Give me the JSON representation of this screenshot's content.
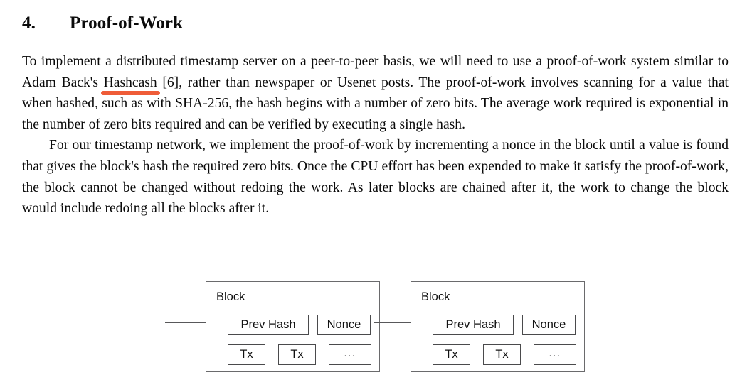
{
  "document": {
    "section": {
      "number": "4.",
      "title": "Proof-of-Work"
    },
    "paragraphs": {
      "p1_part1": "To implement a distributed timestamp server on a peer-to-peer basis, we will need to use a proof-of-work system similar to Adam Back's ",
      "p1_highlight": "Hashcash",
      "p1_part2": " [6], rather than newspaper or Usenet posts.  The proof-of-work involves scanning for a value that when hashed, such as with SHA-256, the hash begins with a number of zero bits.  The average work required is exponential in the number of zero bits required and can be verified by executing a single hash.",
      "p2": "For our timestamp network, we implement the proof-of-work by incrementing a nonce in the block until a value is found that gives the block's hash the required zero bits.  Once the CPU effort has been expended to make it satisfy the proof-of-work, the block cannot be changed without redoing the work.  As later blocks are chained after it, the work to change the block would include redoing all the blocks after it."
    },
    "annotation": {
      "type": "marker-underline",
      "target_word": "Hashcash",
      "color": "#ef5c38"
    }
  },
  "diagram": {
    "name": "blockchain-block-diagram",
    "blocks": [
      {
        "label": "Block",
        "prev_hash": "Prev Hash",
        "nonce": "Nonce",
        "tx1": "Tx",
        "tx2": "Tx",
        "ellipsis": "..."
      },
      {
        "label": "Block",
        "prev_hash": "Prev Hash",
        "nonce": "Nonce",
        "tx1": "Tx",
        "tx2": "Tx",
        "ellipsis": "..."
      }
    ],
    "colors": {
      "box_border": "#6a6a6c",
      "field_border": "#4a4a4c",
      "arrow": "#111111",
      "text": "#111111"
    }
  }
}
